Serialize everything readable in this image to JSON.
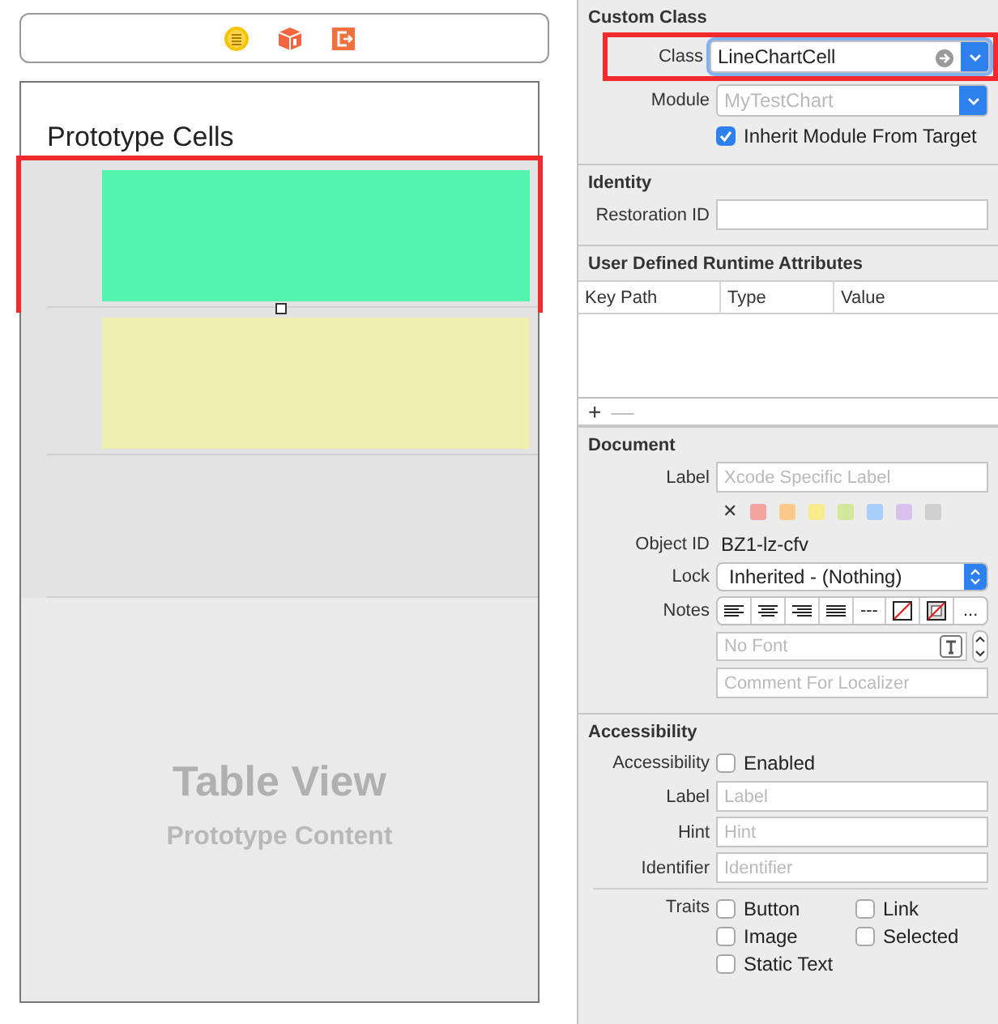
{
  "storyboard": {
    "dock_icons": [
      {
        "kind": "controller"
      },
      {
        "kind": "responder"
      },
      {
        "kind": "exit"
      }
    ],
    "table_view": {
      "header": "Prototype Cells",
      "cells": [
        {
          "kind": "content",
          "color": "#52f4ae",
          "selected": true
        },
        {
          "kind": "content",
          "color": "#f0efb0",
          "selected": false
        },
        {
          "kind": "blank",
          "selected": false
        }
      ],
      "placeholder_title": "Table View",
      "placeholder_subtitle": "Prototype Content"
    }
  },
  "inspector": {
    "sections": [
      {
        "title": "Custom Class",
        "rows": [
          {
            "kind": "combo",
            "label": "Class",
            "value": "LineChartCell",
            "focused": true,
            "highlighted": true
          },
          {
            "kind": "combo",
            "label": "Module",
            "placeholder": "MyTestChart",
            "focused": false,
            "highlighted": false
          },
          {
            "kind": "checkbox",
            "option": "Inherit Module From Target",
            "checked": true
          }
        ]
      },
      {
        "title": "Identity",
        "rows": [
          {
            "kind": "text",
            "label": "Restoration ID"
          }
        ]
      },
      {
        "title": "User Defined Runtime Attributes",
        "rows": [
          {
            "kind": "table",
            "columns": [
              "Key Path",
              "Type",
              "Value"
            ],
            "add": {
              "text": "+",
              "disabled": false
            },
            "remove": {
              "text": "—",
              "disabled": true
            }
          }
        ]
      },
      {
        "title": "Document",
        "rows": [
          {
            "kind": "text",
            "label": "Label",
            "placeholder": "Xcode Specific Label"
          },
          {
            "kind": "swatches",
            "clear": "✕",
            "colors": [
              {
                "color": "#f3a3a0"
              },
              {
                "color": "#fbca8a"
              },
              {
                "color": "#f8ec8c"
              },
              {
                "color": "#d3e79a"
              },
              {
                "color": "#a7cdf8"
              },
              {
                "color": "#d9c2ef"
              },
              {
                "color": "#cfcfcf"
              }
            ]
          },
          {
            "kind": "info",
            "label": "Object ID",
            "value": "BZ1-lz-cfv"
          },
          {
            "kind": "popup",
            "label": "Lock",
            "value": "Inherited - (Nothing)"
          },
          {
            "kind": "toolbar",
            "label": "Notes",
            "buttons": [
              {
                "kind": "align-left"
              },
              {
                "kind": "align-center"
              },
              {
                "kind": "align-right"
              },
              {
                "kind": "justify"
              },
              {
                "kind": "label",
                "text": "---"
              },
              {
                "kind": "no-color"
              },
              {
                "kind": "no-background"
              },
              {
                "kind": "menu",
                "text": "..."
              }
            ]
          },
          {
            "kind": "font",
            "placeholder": "No Font"
          },
          {
            "kind": "text",
            "placeholder": "Comment For Localizer"
          }
        ]
      },
      {
        "title": "Accessibility",
        "rows": [
          {
            "kind": "checkbox",
            "label": "Accessibility",
            "option": "Enabled",
            "checked": false
          },
          {
            "kind": "text",
            "label": "Label",
            "placeholder": "Label"
          },
          {
            "kind": "text",
            "label": "Hint",
            "placeholder": "Hint"
          },
          {
            "kind": "text",
            "label": "Identifier",
            "placeholder": "Identifier"
          },
          {
            "kind": "traits",
            "label": "Traits",
            "options": [
              {
                "text": "Button",
                "checked": false
              },
              {
                "text": "Link",
                "checked": false
              },
              {
                "text": "Image",
                "checked": false
              },
              {
                "text": "Selected",
                "checked": false
              },
              {
                "text": "Static Text",
                "checked": false
              }
            ]
          }
        ]
      }
    ]
  }
}
